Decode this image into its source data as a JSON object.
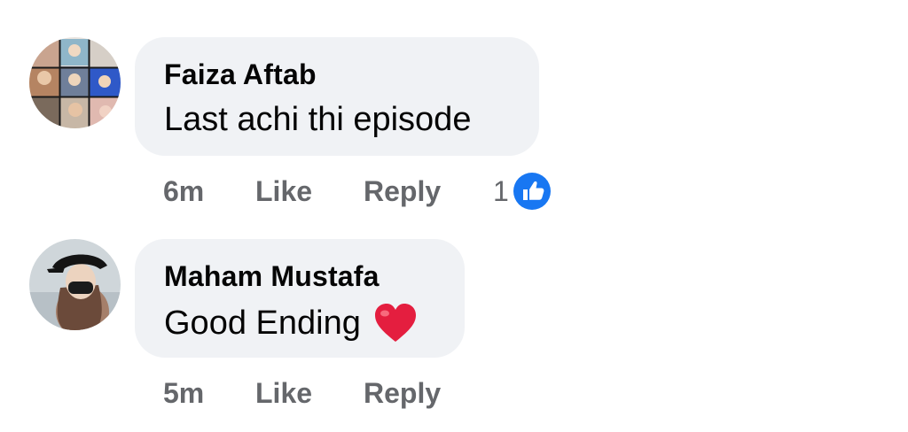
{
  "comments": [
    {
      "author": "Faiza Aftab",
      "text": "Last achi thi episode",
      "time": "6m",
      "like_label": "Like",
      "reply_label": "Reply",
      "reaction_count": "1",
      "reaction_icon": "like-icon"
    },
    {
      "author": "Maham Mustafa",
      "text": "Good Ending",
      "emoji": "heart-icon",
      "time": "5m",
      "like_label": "Like",
      "reply_label": "Reply"
    }
  ],
  "colors": {
    "bubble": "#f0f2f5",
    "text": "#050505",
    "meta": "#65676b",
    "like_blue": "#1877f2",
    "heart_red": "#e41e3f"
  }
}
